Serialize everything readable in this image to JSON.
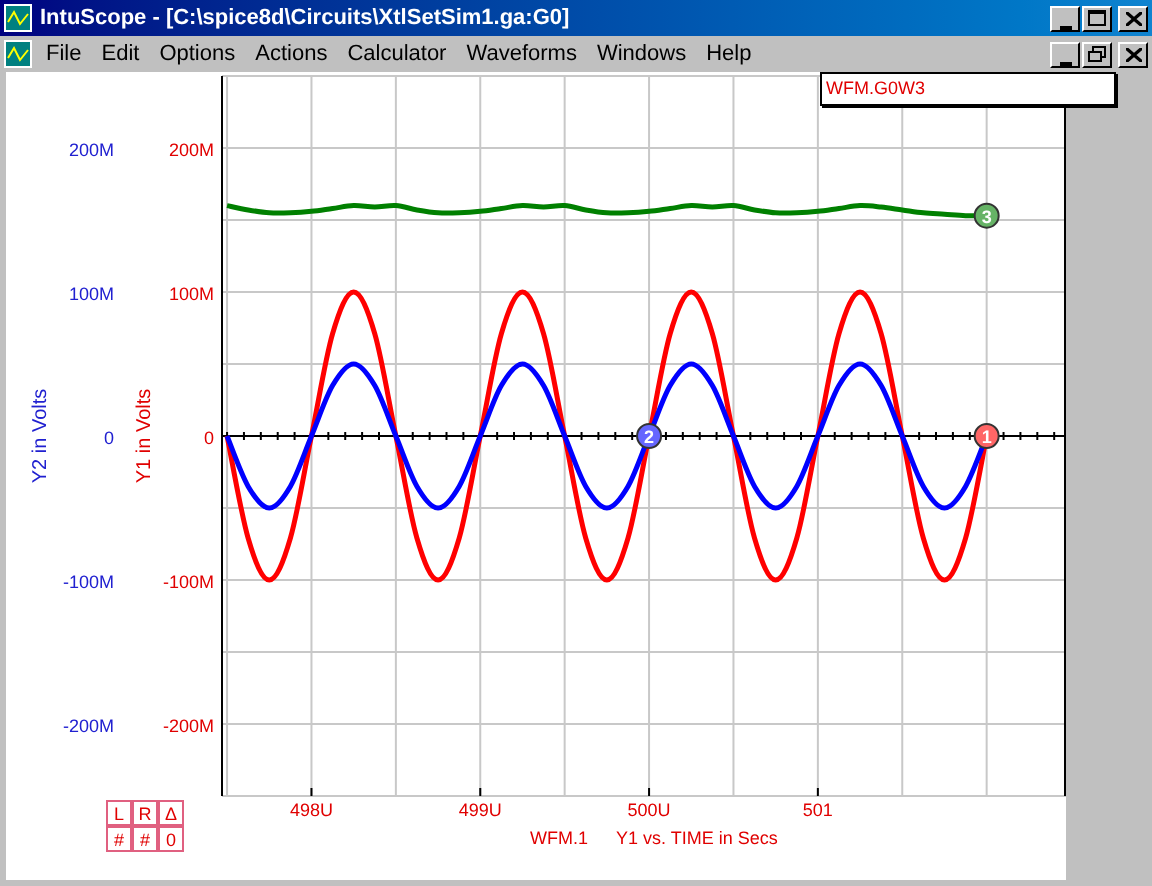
{
  "window": {
    "title": "IntuScope - [C:\\spice8d\\Circuits\\XtlSetSim1.ga:G0]"
  },
  "menu": [
    "File",
    "Edit",
    "Options",
    "Actions",
    "Calculator",
    "Waveforms",
    "Windows",
    "Help"
  ],
  "legend_box": {
    "label": "WFM.G0W3"
  },
  "y2_axis": {
    "title": "Y2 in Volts",
    "ticks": [
      "200M",
      "100M",
      "0",
      "-100M",
      "-200M"
    ]
  },
  "chart_data": {
    "type": "line",
    "ylabel": "Y1 in Volts",
    "xlabel": "Y1 vs. TIME in Secs",
    "x": [
      497.5,
      497.625,
      497.75,
      497.875,
      498,
      498.125,
      498.25,
      498.375,
      498.5,
      498.625,
      498.75,
      498.875,
      499,
      499.125,
      499.25,
      499.375,
      499.5,
      499.625,
      499.75,
      499.875,
      500,
      500.125,
      500.25,
      500.375,
      500.5,
      500.625,
      500.75,
      500.875,
      501,
      501.125,
      501.25,
      501.375,
      501.5,
      501.625,
      501.75,
      501.875,
      502
    ],
    "xlim": [
      497.47,
      502.47
    ],
    "ylim": [
      -250,
      250
    ],
    "xticks": [
      {
        "value": 498,
        "label": "498U"
      },
      {
        "value": 499,
        "label": "499U"
      },
      {
        "value": 500,
        "label": "500U"
      },
      {
        "value": 501,
        "label": "501"
      }
    ],
    "yticks": [
      {
        "value": 200,
        "label": "200M"
      },
      {
        "value": 100,
        "label": "100M"
      },
      {
        "value": 0,
        "label": "0"
      },
      {
        "value": -100,
        "label": "-100M"
      },
      {
        "value": -200,
        "label": "-200M"
      }
    ],
    "series": [
      {
        "name": "1",
        "color": "#ff0000",
        "values": [
          0,
          -71,
          -100,
          -71,
          0,
          71,
          100,
          71,
          0,
          -71,
          -100,
          -71,
          0,
          71,
          100,
          71,
          0,
          -71,
          -100,
          -71,
          0,
          71,
          100,
          71,
          0,
          -71,
          -100,
          -71,
          0,
          71,
          100,
          71,
          0,
          -71,
          -100,
          -71,
          0
        ]
      },
      {
        "name": "2",
        "color": "#0000ff",
        "values": [
          0,
          -35,
          -50,
          -35,
          0,
          35,
          50,
          35,
          0,
          -35,
          -50,
          -35,
          0,
          35,
          50,
          35,
          0,
          -35,
          -50,
          -35,
          0,
          35,
          50,
          35,
          0,
          -35,
          -50,
          -35,
          0,
          35,
          50,
          35,
          0,
          -35,
          -50,
          -35,
          0
        ]
      },
      {
        "name": "3",
        "color": "#008000",
        "values": [
          160,
          157,
          155,
          155,
          156,
          158,
          160,
          159,
          160,
          157,
          155,
          155,
          156,
          158,
          160,
          159,
          160,
          157,
          155,
          155,
          156,
          158,
          160,
          159,
          160,
          157,
          155,
          155,
          156,
          158,
          160,
          159,
          157,
          155,
          154,
          153,
          153
        ]
      }
    ],
    "grid": true
  },
  "markers": [
    {
      "kind": "end"
    },
    {
      "kind": "crossing"
    },
    {
      "kind": "end"
    }
  ],
  "footer": {
    "waveform": "WFM.1"
  },
  "cursor_buttons": [
    "L",
    "R",
    "Δ",
    "#",
    "#",
    "0"
  ]
}
